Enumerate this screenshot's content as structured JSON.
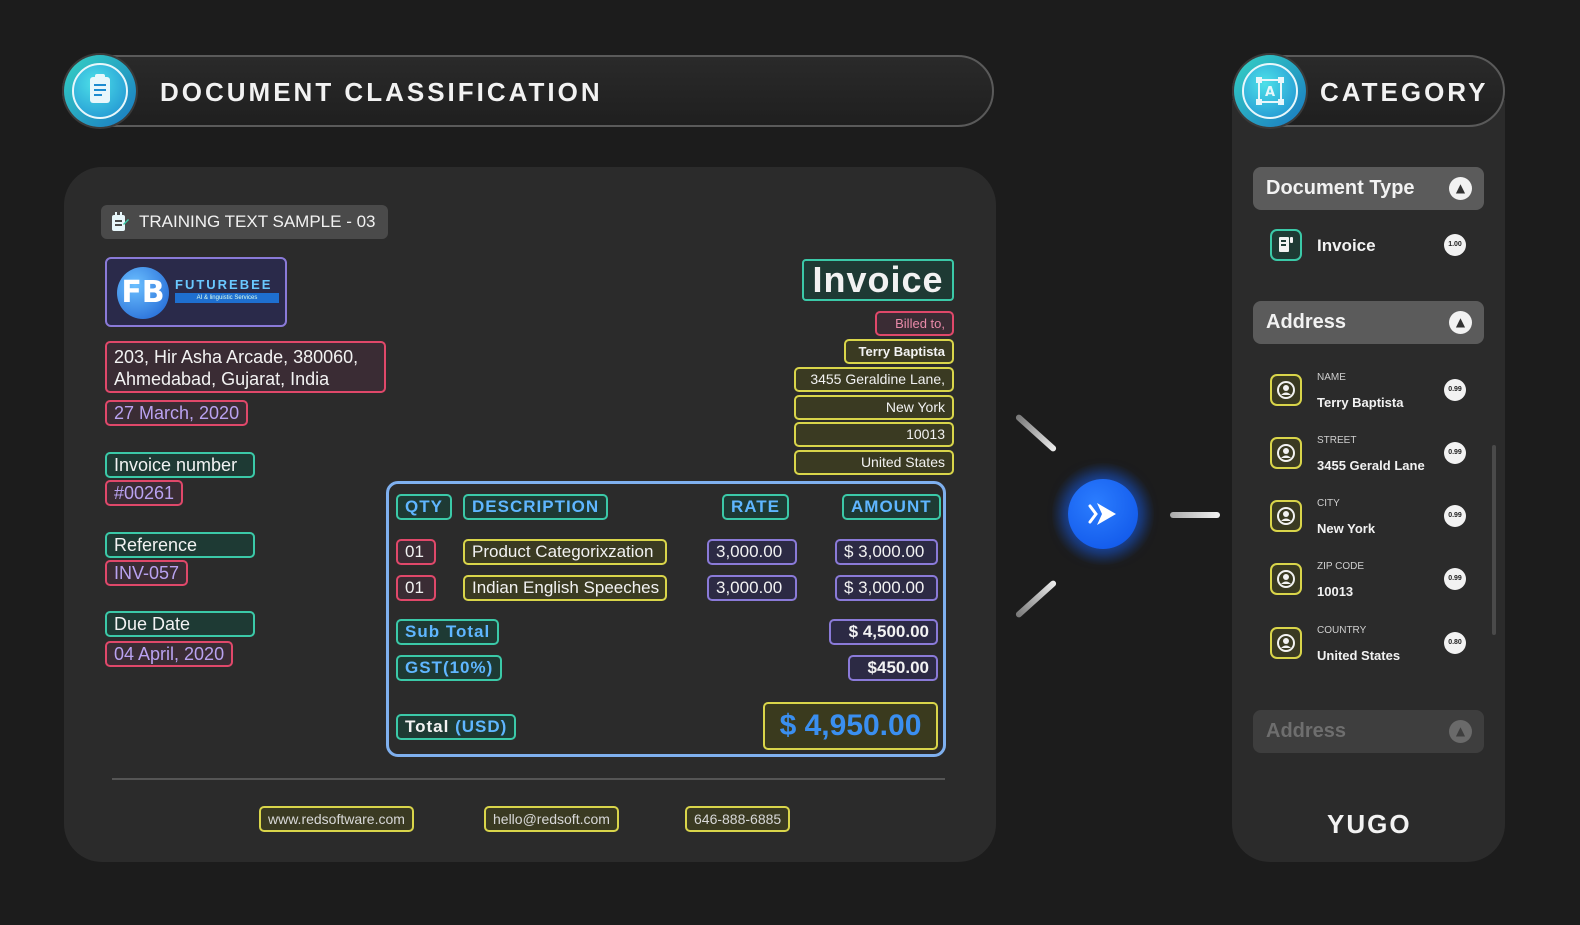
{
  "header": {
    "title": "DOCUMENT CLASSIFICATION",
    "category_title": "CATEGORY"
  },
  "sample": {
    "label": "TRAINING TEXT SAMPLE - 03"
  },
  "logo": {
    "name": "FUTUREBEE",
    "tagline": "AI & linguistic Services"
  },
  "sender": {
    "address_line1": "203, Hir Asha Arcade, 380060,",
    "address_line2": "Ahmedabad, Gujarat, India",
    "date": "27 March, 2020"
  },
  "meta": [
    {
      "label": "Invoice number",
      "value": "#00261"
    },
    {
      "label": "Reference",
      "value": "INV-057"
    },
    {
      "label": "Due Date",
      "value": "04 April, 2020"
    }
  ],
  "invoice": {
    "title": "Invoice",
    "billed_to_label": "Billed to,",
    "name": "Terry Baptista",
    "street": "3455  Geraldine Lane,",
    "city": "New York",
    "zip": "10013",
    "country": "United States"
  },
  "table": {
    "headers": {
      "qty": "QTY",
      "description": "DESCRIPTION",
      "rate": "RATE",
      "amount": "AMOUNT"
    },
    "rows": [
      {
        "qty": "01",
        "description": "Product Categorixzation",
        "rate": "3,000.00",
        "amount": "$ 3,000.00"
      },
      {
        "qty": "01",
        "description": "Indian English Speeches",
        "rate": "3,000.00",
        "amount": "$ 3,000.00"
      }
    ],
    "subtotal_label": "Sub Total",
    "subtotal_value": "$ 4,500.00",
    "gst_label": "GST(10%)",
    "gst_value": "$450.00",
    "total_label": "Total",
    "total_currency": "(USD)",
    "total_value": "$ 4,950.00"
  },
  "footer": {
    "website": "www.redsoftware.com",
    "email": "hello@redsoft.com",
    "phone": "646-888-6885"
  },
  "category": {
    "document_type_header": "Document Type",
    "document_type": {
      "value": "Invoice",
      "score": "1.00"
    },
    "address_header": "Address",
    "fields": [
      {
        "label": "NAME",
        "value": "Terry Baptista",
        "score": "0.99"
      },
      {
        "label": "STREET",
        "value": "3455 Gerald Lane",
        "score": "0.99"
      },
      {
        "label": "CITY",
        "value": "New York",
        "score": "0.99"
      },
      {
        "label": "ZIP CODE",
        "value": "10013",
        "score": "0.99"
      },
      {
        "label": "COUNTRY",
        "value": "United States",
        "score": "0.80"
      }
    ],
    "collapsed_header": "Address"
  },
  "brand": "YUGO",
  "colors": {
    "red": "#e0486a",
    "teal": "#3bc9a8",
    "yellow": "#d9d54a",
    "purple": "#8a7ad8",
    "blue_accent": "#0d52e6",
    "table_border": "#7fb0ef"
  },
  "icons": {
    "header": "clipboard-icon",
    "category": "text-recognition-icon",
    "sample": "notepad-icon",
    "field": "user-icon",
    "document": "document-icon",
    "chevron": "chevron-up-icon",
    "action": "play-icon"
  }
}
